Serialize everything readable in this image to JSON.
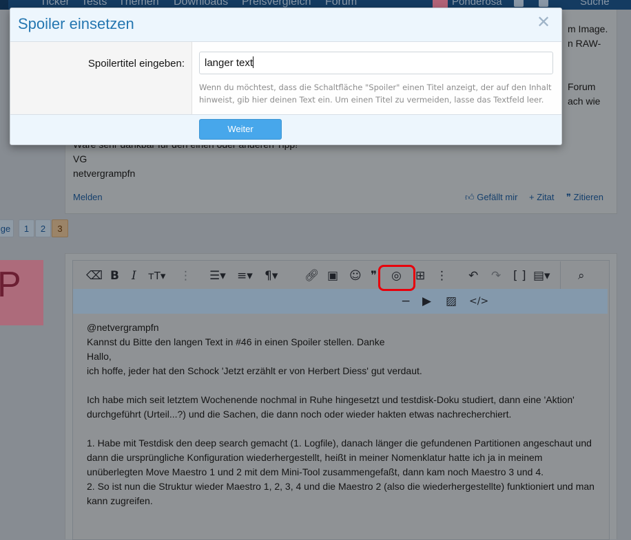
{
  "topnav": {
    "items": [
      "Ticker",
      "Tests",
      "Themen",
      "Downloads",
      "Preisvergleich",
      "Forum"
    ],
    "user": "Ponderosa",
    "search": "Suche"
  },
  "post": {
    "right_fragments": [
      "m Image.",
      "n RAW-",
      "Forum",
      "ach wie"
    ],
    "partial_line": "Wäre sehr dankbar für den einen oder anderen Tipp!",
    "lines": [
      "VG",
      "netvergrampfn"
    ],
    "actions": {
      "report": "Melden",
      "like": "Gefällt mir",
      "quote_plus": "+ Zitat",
      "quote": "Zitieren"
    }
  },
  "pagination": {
    "prev": "ge",
    "pages": [
      "1",
      "2",
      "3"
    ],
    "current": "3"
  },
  "avatar": {
    "letter": "P"
  },
  "editor": {
    "paragraphs": [
      "@netvergrampfn",
      "Kannst du Bitte den langen Text in #46 in einen Spoiler stellen. Danke",
      "Hallo,",
      "ich hoffe, jeder hat den Schock 'Jetzt erzählt er von Herbert Diess' gut verdaut.",
      "",
      "Ich habe mich seit letztem Wochenende nochmal in Ruhe hingesetzt und testdisk-Doku studiert, dann eine 'Aktion' durchgeführt (Urteil...?) und die Sachen, die dann noch oder wieder hakten etwas nachrecherchiert.",
      "",
      "1. Habe mit Testdisk den deep search gemacht (1. Logfile), danach länger die gefundenen Partitionen angeschaut und dann die ursprüngliche Konfiguration wiederhergestellt, heißt in meiner Nomenklatur hatte ich ja in meinem unüberlegten Move Maestro 1 und 2 mit dem Mini-Tool zusammengefaßt, dann kam noch Maestro 3 und 4.",
      "2. So ist nun die Struktur wieder Maestro 1, 2, 3, 4 und die Maestro 2 (also die wiederhergestellte) funktioniert und man kann zugreifen."
    ],
    "toolbar_icons": [
      "eraser-icon",
      "bold-icon",
      "italic-icon",
      "text-size-icon",
      "more-vertical-icon",
      "list-icon",
      "align-icon",
      "paragraph-icon",
      "link-icon",
      "image-icon",
      "smiley-icon",
      "quote-icon",
      "spoiler-icon",
      "table-icon",
      "more-icon",
      "undo-icon",
      "redo-icon",
      "bbcode-icon",
      "drafts-icon",
      "preview-icon",
      "horizontal-line-icon",
      "media-icon",
      "gallery-icon",
      "code-icon"
    ]
  },
  "modal": {
    "title": "Spoiler einsetzen",
    "close": "✕",
    "label": "Spoilertitel eingeben:",
    "input_value": "langer text",
    "hint": "Wenn du möchtest, dass die Schaltfläche \"Spoiler\" einen Titel anzeigt, der auf den Inhalt hinweist, gib hier deinen Text ein. Um einen Titel zu vermeiden, lasse das Textfeld leer.",
    "button": "Weiter"
  },
  "colors": {
    "accent": "#2577b1",
    "button": "#47a7eb",
    "highlight_ring": "#e8000b",
    "overlay": "#878c92"
  }
}
